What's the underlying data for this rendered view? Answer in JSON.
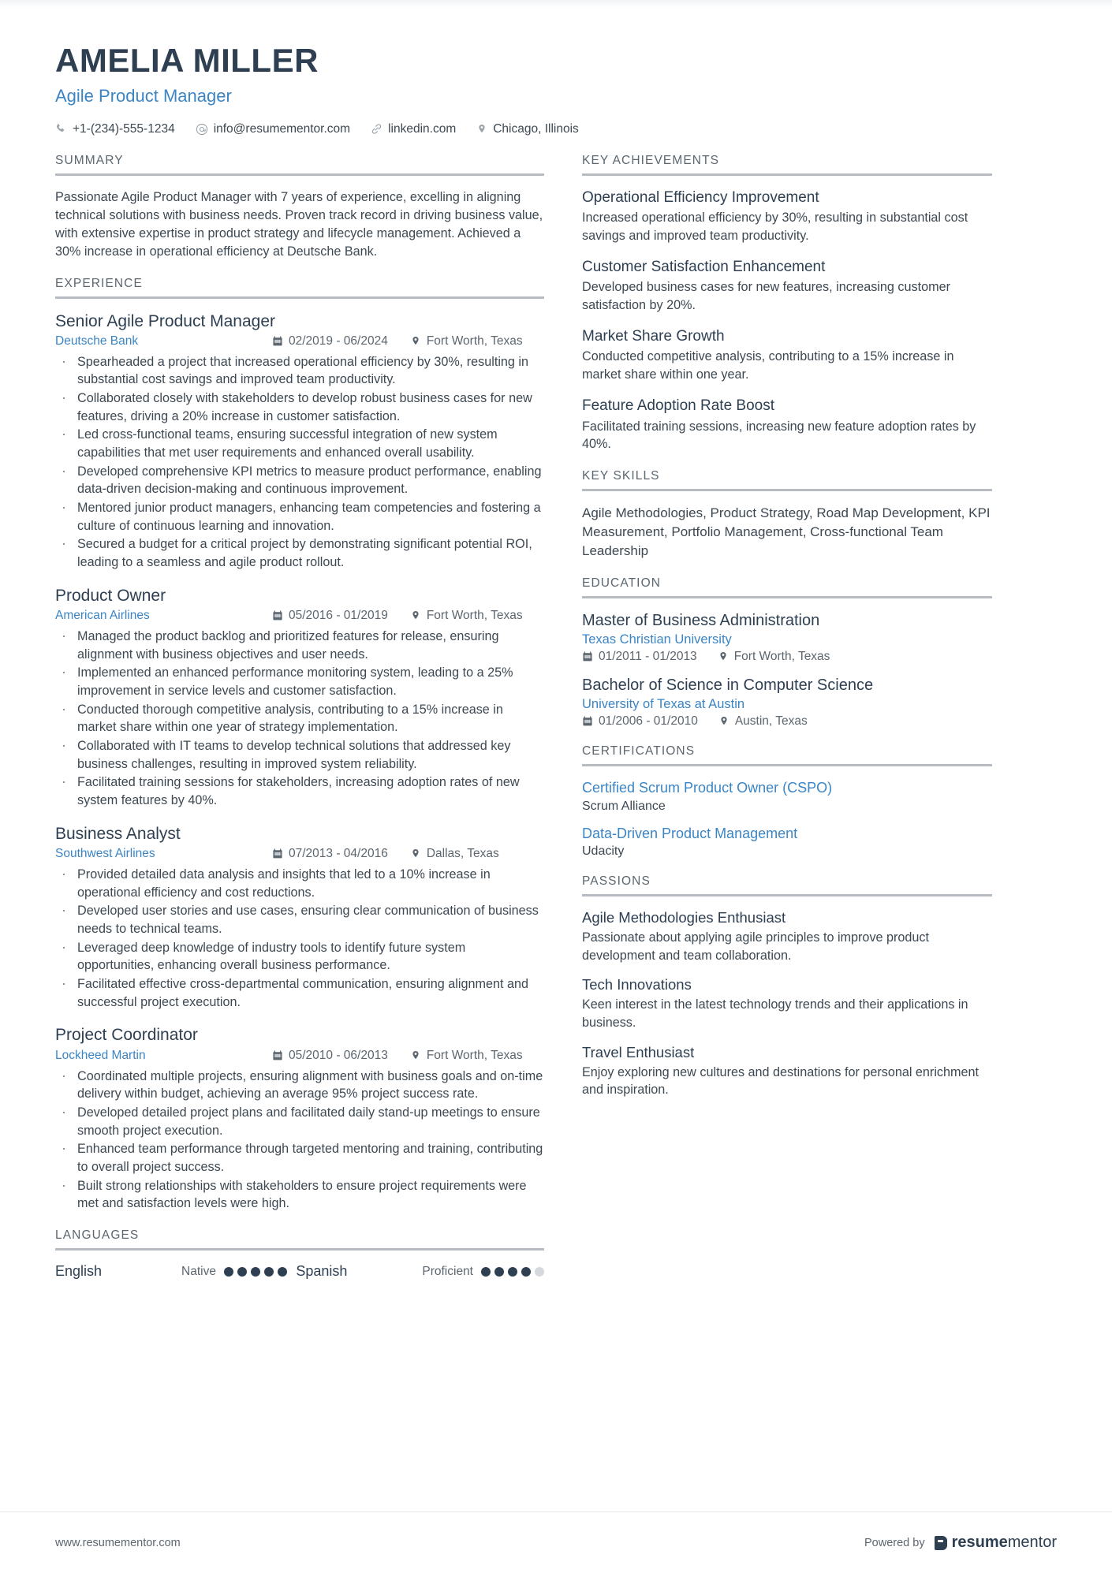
{
  "header": {
    "name": "AMELIA MILLER",
    "job_title": "Agile Product Manager",
    "contacts": [
      {
        "icon": "phone-icon",
        "text": "+1-(234)-555-1234"
      },
      {
        "icon": "email-icon",
        "text": "info@resumementor.com"
      },
      {
        "icon": "link-icon",
        "text": "linkedin.com"
      },
      {
        "icon": "location-pin-icon",
        "text": "Chicago, Illinois"
      }
    ]
  },
  "summary": {
    "heading": "SUMMARY",
    "text": "Passionate Agile Product Manager with 7 years of experience, excelling in aligning technical solutions with business needs. Proven track record in driving business value, with extensive expertise in product strategy and lifecycle management. Achieved a 30% increase in operational efficiency at Deutsche Bank."
  },
  "experience": {
    "heading": "EXPERIENCE",
    "jobs": [
      {
        "role": "Senior Agile Product Manager",
        "company": "Deutsche Bank",
        "dates": "02/2019 - 06/2024",
        "location": "Fort Worth, Texas",
        "bullets": [
          "Spearheaded a project that increased operational efficiency by 30%, resulting in substantial cost savings and improved team productivity.",
          "Collaborated closely with stakeholders to develop robust business cases for new features, driving a 20% increase in customer satisfaction.",
          "Led cross-functional teams, ensuring successful integration of new system capabilities that met user requirements and enhanced overall usability.",
          "Developed comprehensive KPI metrics to measure product performance, enabling data-driven decision-making and continuous improvement.",
          "Mentored junior product managers, enhancing team competencies and fostering a culture of continuous learning and innovation.",
          "Secured a budget for a critical project by demonstrating significant potential ROI, leading to a seamless and agile product rollout."
        ]
      },
      {
        "role": "Product Owner",
        "company": "American Airlines",
        "dates": "05/2016 - 01/2019",
        "location": "Fort Worth, Texas",
        "bullets": [
          "Managed the product backlog and prioritized features for release, ensuring alignment with business objectives and user needs.",
          "Implemented an enhanced performance monitoring system, leading to a 25% improvement in service levels and customer satisfaction.",
          "Conducted thorough competitive analysis, contributing to a 15% increase in market share within one year of strategy implementation.",
          "Collaborated with IT teams to develop technical solutions that addressed key business challenges, resulting in improved system reliability.",
          "Facilitated training sessions for stakeholders, increasing adoption rates of new system features by 40%."
        ]
      },
      {
        "role": "Business Analyst",
        "company": "Southwest Airlines",
        "dates": "07/2013 - 04/2016",
        "location": "Dallas, Texas",
        "bullets": [
          "Provided detailed data analysis and insights that led to a 10% increase in operational efficiency and cost reductions.",
          "Developed user stories and use cases, ensuring clear communication of business needs to technical teams.",
          "Leveraged deep knowledge of industry tools to identify future system opportunities, enhancing overall business performance.",
          "Facilitated effective cross-departmental communication, ensuring alignment and successful project execution."
        ]
      },
      {
        "role": "Project Coordinator",
        "company": "Lockheed Martin",
        "dates": "05/2010 - 06/2013",
        "location": "Fort Worth, Texas",
        "bullets": [
          "Coordinated multiple projects, ensuring alignment with business goals and on-time delivery within budget, achieving an average 95% project success rate.",
          "Developed detailed project plans and facilitated daily stand-up meetings to ensure smooth project execution.",
          "Enhanced team performance through targeted mentoring and training, contributing to overall project success.",
          "Built strong relationships with stakeholders to ensure project requirements were met and satisfaction levels were high."
        ]
      }
    ]
  },
  "languages": {
    "heading": "LANGUAGES",
    "items": [
      {
        "name": "English",
        "level": "Native",
        "filled": 5,
        "total": 5
      },
      {
        "name": "Spanish",
        "level": "Proficient",
        "filled": 4,
        "total": 5
      }
    ]
  },
  "key_achievements": {
    "heading": "KEY ACHIEVEMENTS",
    "items": [
      {
        "title": "Operational Efficiency Improvement",
        "desc": "Increased operational efficiency by 30%, resulting in substantial cost savings and improved team productivity."
      },
      {
        "title": "Customer Satisfaction Enhancement",
        "desc": "Developed business cases for new features, increasing customer satisfaction by 20%."
      },
      {
        "title": "Market Share Growth",
        "desc": "Conducted competitive analysis, contributing to a 15% increase in market share within one year."
      },
      {
        "title": "Feature Adoption Rate Boost",
        "desc": "Facilitated training sessions, increasing new feature adoption rates by 40%."
      }
    ]
  },
  "key_skills": {
    "heading": "KEY SKILLS",
    "text": "Agile Methodologies, Product Strategy, Road Map Development, KPI Measurement, Portfolio Management, Cross-functional Team Leadership"
  },
  "education": {
    "heading": "EDUCATION",
    "items": [
      {
        "degree": "Master of Business Administration",
        "school": "Texas Christian University",
        "dates": "01/2011 - 01/2013",
        "location": "Fort Worth, Texas"
      },
      {
        "degree": "Bachelor of Science in Computer Science",
        "school": "University of Texas at Austin",
        "dates": "01/2006 - 01/2010",
        "location": "Austin, Texas"
      }
    ]
  },
  "certifications": {
    "heading": "CERTIFICATIONS",
    "items": [
      {
        "name": "Certified Scrum Product Owner (CSPO)",
        "issuer": "Scrum Alliance"
      },
      {
        "name": "Data-Driven Product Management",
        "issuer": "Udacity"
      }
    ]
  },
  "passions": {
    "heading": "PASSIONS",
    "items": [
      {
        "title": "Agile Methodologies Enthusiast",
        "desc": "Passionate about applying agile principles to improve product development and team collaboration."
      },
      {
        "title": "Tech Innovations",
        "desc": "Keen interest in the latest technology trends and their applications in business."
      },
      {
        "title": "Travel Enthusiast",
        "desc": "Enjoy exploring new cultures and destinations for personal enrichment and inspiration."
      }
    ]
  },
  "footer": {
    "url": "www.resumementor.com",
    "powered_by": "Powered by",
    "brand_first": "resume",
    "brand_second": "mentor"
  },
  "colors": {
    "accent_blue": "#3b85c4",
    "heading_dark": "#2e3f52",
    "body_text": "#3d4852",
    "rule_gray": "#b6bcc2"
  }
}
